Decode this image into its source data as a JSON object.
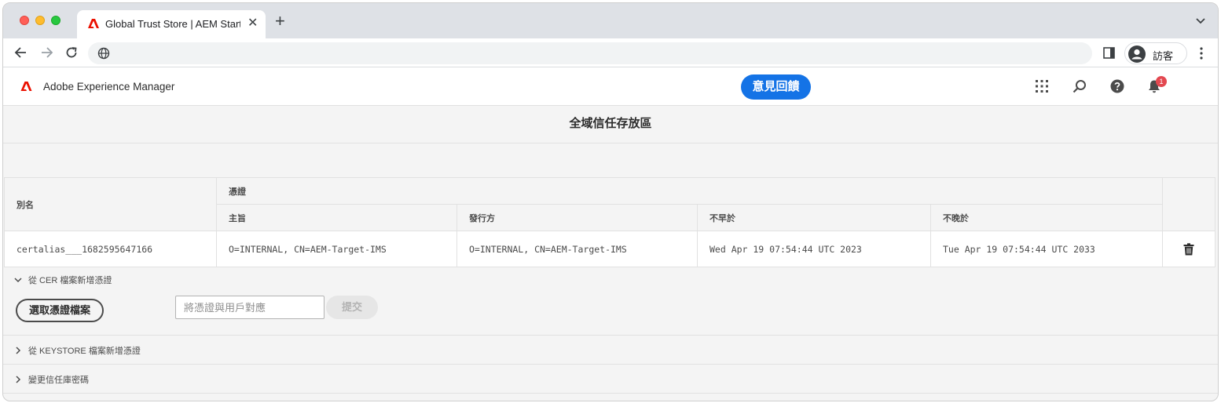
{
  "browser": {
    "tab_title": "Global Trust Store | AEM Start",
    "profile_label": "訪客"
  },
  "aem": {
    "app_name": "Adobe Experience Manager",
    "feedback_label": "意見回饋",
    "notification_count": "1",
    "brand_color": "#eb1000",
    "accent_color": "#1473e6"
  },
  "page": {
    "title": "全域信任存放區"
  },
  "table": {
    "alias_header": "別名",
    "cert_group_header": "憑證",
    "columns": [
      "主旨",
      "發行方",
      "不早於",
      "不晚於"
    ],
    "rows": [
      {
        "alias": "certalias___1682595647166",
        "subject": "O=INTERNAL, CN=AEM-Target-IMS",
        "issuer": "O=INTERNAL, CN=AEM-Target-IMS",
        "not_before": "Wed Apr 19 07:54:44 UTC 2023",
        "not_after": "Tue Apr 19 07:54:44 UTC 2033"
      }
    ]
  },
  "sections": {
    "cer": {
      "label": "從 CER 檔案新增憑證",
      "expanded": true,
      "pick_label": "選取憑證檔案",
      "alias_placeholder": "將憑證與用戶對應",
      "submit_label": "提交"
    },
    "keystore": {
      "label": "從 KEYSTORE 檔案新增憑證",
      "expanded": false
    },
    "password": {
      "label": "變更信任庫密碼",
      "expanded": false
    }
  }
}
